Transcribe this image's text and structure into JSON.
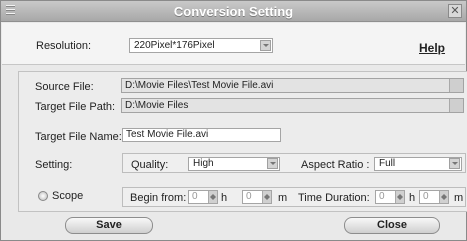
{
  "window": {
    "title": "Conversion Setting",
    "close_glyph": "✕"
  },
  "resolution": {
    "label": "Resolution:",
    "value": "220Pixel*176Pixel"
  },
  "help_label": "Help",
  "source_file": {
    "label": "Source File:",
    "value": "D:\\Movie Files\\Test Movie File.avi"
  },
  "target_path": {
    "label": "Target File Path:",
    "value": "D:\\Movie Files"
  },
  "target_name": {
    "label": "Target File Name:",
    "value": "Test Movie File.avi"
  },
  "setting": {
    "label": "Setting:",
    "quality_label": "Quality:",
    "quality_value": "High",
    "aspect_label": "Aspect Ratio :",
    "aspect_value": "Full"
  },
  "scope": {
    "label": "Scope",
    "begin_label": "Begin from:",
    "begin_hours": "0",
    "hours_unit": "h",
    "begin_minutes": "0",
    "minutes_unit": "m",
    "duration_label": "Time Duration:",
    "duration_hours": "0",
    "duration_minutes": "0"
  },
  "buttons": {
    "save": "Save",
    "close": "Close"
  }
}
